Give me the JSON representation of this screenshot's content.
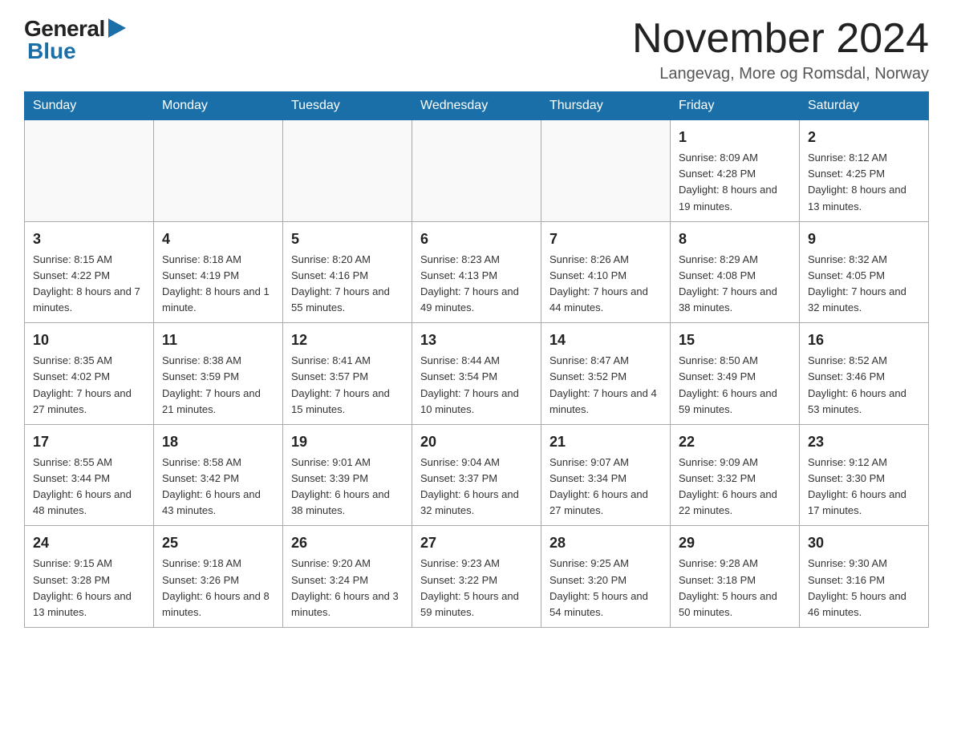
{
  "logo": {
    "general": "General",
    "blue": "Blue"
  },
  "header": {
    "title": "November 2024",
    "subtitle": "Langevag, More og Romsdal, Norway"
  },
  "days_of_week": [
    "Sunday",
    "Monday",
    "Tuesday",
    "Wednesday",
    "Thursday",
    "Friday",
    "Saturday"
  ],
  "weeks": [
    [
      {
        "day": "",
        "sunrise": "",
        "sunset": "",
        "daylight": ""
      },
      {
        "day": "",
        "sunrise": "",
        "sunset": "",
        "daylight": ""
      },
      {
        "day": "",
        "sunrise": "",
        "sunset": "",
        "daylight": ""
      },
      {
        "day": "",
        "sunrise": "",
        "sunset": "",
        "daylight": ""
      },
      {
        "day": "",
        "sunrise": "",
        "sunset": "",
        "daylight": ""
      },
      {
        "day": "1",
        "sunrise": "Sunrise: 8:09 AM",
        "sunset": "Sunset: 4:28 PM",
        "daylight": "Daylight: 8 hours and 19 minutes."
      },
      {
        "day": "2",
        "sunrise": "Sunrise: 8:12 AM",
        "sunset": "Sunset: 4:25 PM",
        "daylight": "Daylight: 8 hours and 13 minutes."
      }
    ],
    [
      {
        "day": "3",
        "sunrise": "Sunrise: 8:15 AM",
        "sunset": "Sunset: 4:22 PM",
        "daylight": "Daylight: 8 hours and 7 minutes."
      },
      {
        "day": "4",
        "sunrise": "Sunrise: 8:18 AM",
        "sunset": "Sunset: 4:19 PM",
        "daylight": "Daylight: 8 hours and 1 minute."
      },
      {
        "day": "5",
        "sunrise": "Sunrise: 8:20 AM",
        "sunset": "Sunset: 4:16 PM",
        "daylight": "Daylight: 7 hours and 55 minutes."
      },
      {
        "day": "6",
        "sunrise": "Sunrise: 8:23 AM",
        "sunset": "Sunset: 4:13 PM",
        "daylight": "Daylight: 7 hours and 49 minutes."
      },
      {
        "day": "7",
        "sunrise": "Sunrise: 8:26 AM",
        "sunset": "Sunset: 4:10 PM",
        "daylight": "Daylight: 7 hours and 44 minutes."
      },
      {
        "day": "8",
        "sunrise": "Sunrise: 8:29 AM",
        "sunset": "Sunset: 4:08 PM",
        "daylight": "Daylight: 7 hours and 38 minutes."
      },
      {
        "day": "9",
        "sunrise": "Sunrise: 8:32 AM",
        "sunset": "Sunset: 4:05 PM",
        "daylight": "Daylight: 7 hours and 32 minutes."
      }
    ],
    [
      {
        "day": "10",
        "sunrise": "Sunrise: 8:35 AM",
        "sunset": "Sunset: 4:02 PM",
        "daylight": "Daylight: 7 hours and 27 minutes."
      },
      {
        "day": "11",
        "sunrise": "Sunrise: 8:38 AM",
        "sunset": "Sunset: 3:59 PM",
        "daylight": "Daylight: 7 hours and 21 minutes."
      },
      {
        "day": "12",
        "sunrise": "Sunrise: 8:41 AM",
        "sunset": "Sunset: 3:57 PM",
        "daylight": "Daylight: 7 hours and 15 minutes."
      },
      {
        "day": "13",
        "sunrise": "Sunrise: 8:44 AM",
        "sunset": "Sunset: 3:54 PM",
        "daylight": "Daylight: 7 hours and 10 minutes."
      },
      {
        "day": "14",
        "sunrise": "Sunrise: 8:47 AM",
        "sunset": "Sunset: 3:52 PM",
        "daylight": "Daylight: 7 hours and 4 minutes."
      },
      {
        "day": "15",
        "sunrise": "Sunrise: 8:50 AM",
        "sunset": "Sunset: 3:49 PM",
        "daylight": "Daylight: 6 hours and 59 minutes."
      },
      {
        "day": "16",
        "sunrise": "Sunrise: 8:52 AM",
        "sunset": "Sunset: 3:46 PM",
        "daylight": "Daylight: 6 hours and 53 minutes."
      }
    ],
    [
      {
        "day": "17",
        "sunrise": "Sunrise: 8:55 AM",
        "sunset": "Sunset: 3:44 PM",
        "daylight": "Daylight: 6 hours and 48 minutes."
      },
      {
        "day": "18",
        "sunrise": "Sunrise: 8:58 AM",
        "sunset": "Sunset: 3:42 PM",
        "daylight": "Daylight: 6 hours and 43 minutes."
      },
      {
        "day": "19",
        "sunrise": "Sunrise: 9:01 AM",
        "sunset": "Sunset: 3:39 PM",
        "daylight": "Daylight: 6 hours and 38 minutes."
      },
      {
        "day": "20",
        "sunrise": "Sunrise: 9:04 AM",
        "sunset": "Sunset: 3:37 PM",
        "daylight": "Daylight: 6 hours and 32 minutes."
      },
      {
        "day": "21",
        "sunrise": "Sunrise: 9:07 AM",
        "sunset": "Sunset: 3:34 PM",
        "daylight": "Daylight: 6 hours and 27 minutes."
      },
      {
        "day": "22",
        "sunrise": "Sunrise: 9:09 AM",
        "sunset": "Sunset: 3:32 PM",
        "daylight": "Daylight: 6 hours and 22 minutes."
      },
      {
        "day": "23",
        "sunrise": "Sunrise: 9:12 AM",
        "sunset": "Sunset: 3:30 PM",
        "daylight": "Daylight: 6 hours and 17 minutes."
      }
    ],
    [
      {
        "day": "24",
        "sunrise": "Sunrise: 9:15 AM",
        "sunset": "Sunset: 3:28 PM",
        "daylight": "Daylight: 6 hours and 13 minutes."
      },
      {
        "day": "25",
        "sunrise": "Sunrise: 9:18 AM",
        "sunset": "Sunset: 3:26 PM",
        "daylight": "Daylight: 6 hours and 8 minutes."
      },
      {
        "day": "26",
        "sunrise": "Sunrise: 9:20 AM",
        "sunset": "Sunset: 3:24 PM",
        "daylight": "Daylight: 6 hours and 3 minutes."
      },
      {
        "day": "27",
        "sunrise": "Sunrise: 9:23 AM",
        "sunset": "Sunset: 3:22 PM",
        "daylight": "Daylight: 5 hours and 59 minutes."
      },
      {
        "day": "28",
        "sunrise": "Sunrise: 9:25 AM",
        "sunset": "Sunset: 3:20 PM",
        "daylight": "Daylight: 5 hours and 54 minutes."
      },
      {
        "day": "29",
        "sunrise": "Sunrise: 9:28 AM",
        "sunset": "Sunset: 3:18 PM",
        "daylight": "Daylight: 5 hours and 50 minutes."
      },
      {
        "day": "30",
        "sunrise": "Sunrise: 9:30 AM",
        "sunset": "Sunset: 3:16 PM",
        "daylight": "Daylight: 5 hours and 46 minutes."
      }
    ]
  ]
}
